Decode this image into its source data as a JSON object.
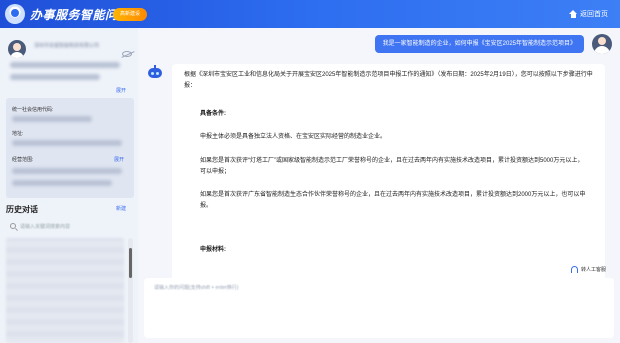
{
  "header": {
    "title": "办事服务智能问答",
    "badge": "高新建设",
    "home_label": "返回首页"
  },
  "sidebar": {
    "company_name": "深圳市安盛智能制造有限公司",
    "expand_label": "展开",
    "credit_code_label": "统一社会信用代码:",
    "address_label": "地址:",
    "qualifications_label": "经营范围:",
    "qualifications_expand": "展开",
    "history_title": "历史对话",
    "new_chat_label": "新建",
    "search_placeholder": "请输入关键词搜索内容"
  },
  "chat": {
    "user_message": "我是一家智能制造的企业，如何申报《宝安区2025年智能制造示范项目》",
    "bot_intro": "根据《深圳市宝安区工业和信息化局关于开展宝安区2025年智能制造示范项目申报工作的通知》（发布日期：2025年2月19日），您可以按照以下步骤进行申报：",
    "section1_title": "具备条件:",
    "para1": "申报主体必须是具备独立法人资格、在宝安区实际经营的制造业企业。",
    "para2": "如果您是首次获评“灯塔工厂”或国家级智能制造示范工厂荣誉称号的企业，且在过去两年内有实施技术改造项目，累计投资额达到5000万元以上，可以申报；",
    "para3": "如果您是首次获评广东省智能制造生态合作伙伴荣誉称号的企业，且在过去两年内有实施技术改造项目，累计投资额达到2000万元以上，也可以申报。",
    "section2_title": "申报材料:",
    "human_service_label": "转人工客服",
    "input_placeholder": "请输入你的问题(支持shift + enter换行)"
  },
  "colors": {
    "header_blue": "#2d6df0",
    "bubble_blue": "#3f74f2",
    "badge_orange": "#ff9d00"
  }
}
